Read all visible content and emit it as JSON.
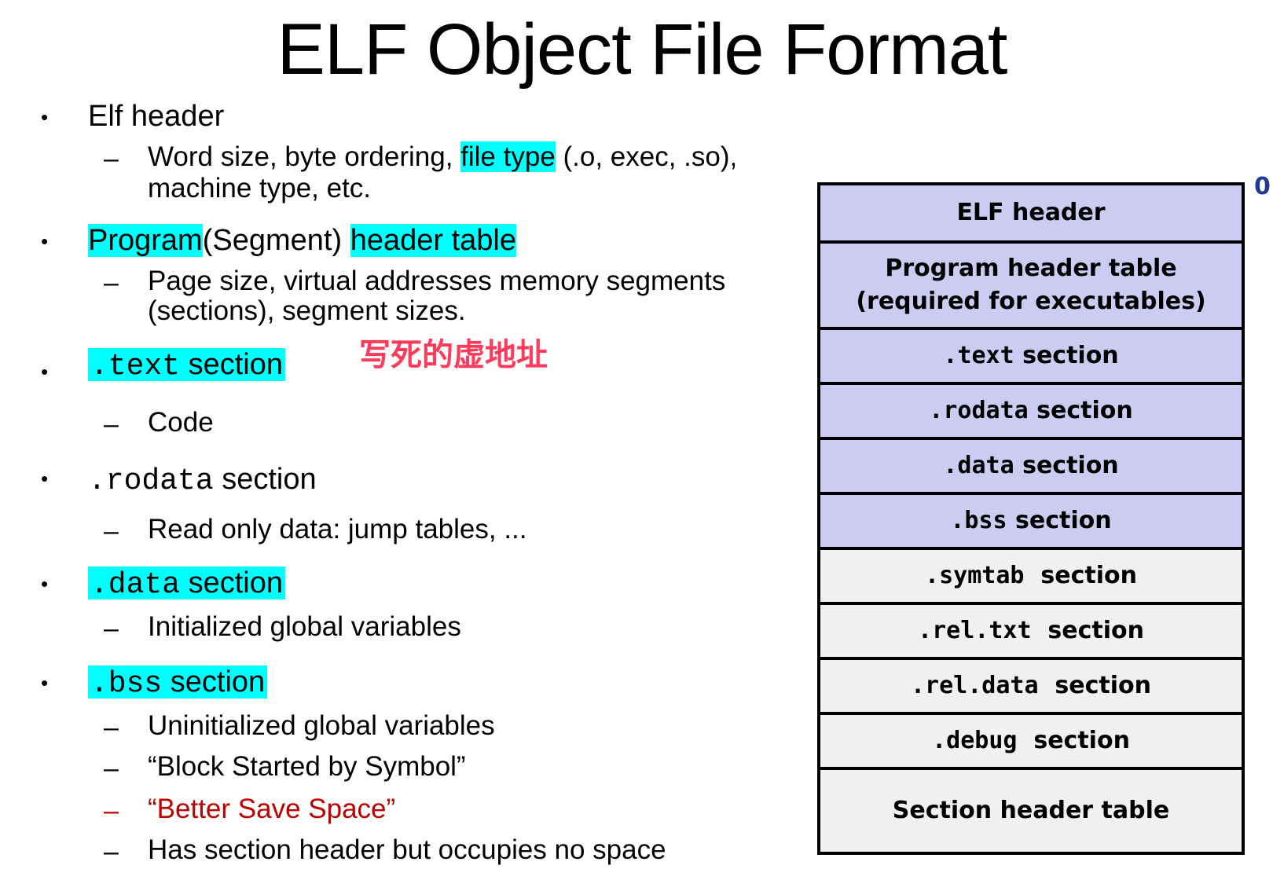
{
  "title": "ELF Object File Format",
  "colors": {
    "highlight": "#00ffff",
    "box_blue": "#ccccf3",
    "box_gray": "#f0f0f0",
    "red_text": "#c00000",
    "note_red": "#ff3b5c",
    "offset_blue": "#1f3a93"
  },
  "bullet_glyph": "•",
  "dash_glyph": "–",
  "left": {
    "elf": {
      "label": "Elf header",
      "sub1_a": "Word size, byte ordering, ",
      "sub1_hl": "file type",
      "sub1_b": " (.o, exec, .so),",
      "sub1_line2": "machine type, etc."
    },
    "program": {
      "hl1": "Program",
      "mid": "(Segment) ",
      "hl2": "header table",
      "sub1": "Page size, virtual addresses memory segments",
      "sub2": "(sections), segment sizes."
    },
    "note": "写死的虚地址",
    "text": {
      "mono": ".text",
      "word": " section",
      "sub": "Code"
    },
    "rodata": {
      "mono": ".rodata",
      "word": " section",
      "sub": "Read only data: jump tables, ..."
    },
    "data": {
      "mono": ".data",
      "word": " section",
      "sub": "Initialized global variables"
    },
    "bss": {
      "mono": ".bss",
      "word": " section",
      "sub1": "Uninitialized global variables",
      "sub2": "“Block Started by Symbol”",
      "sub3": "“Better Save Space”",
      "sub4": "Has section header but occupies no space"
    }
  },
  "diagram": {
    "offset_label": "0",
    "cells": {
      "elf_header": "ELF header",
      "pht_line1": "Program header table",
      "pht_line2": "(required for executables)",
      "text_mono": ".text",
      "text_word": " section",
      "rodata_mono": ".rodata",
      "rodata_word": " section",
      "data_mono": ".data",
      "data_word": " section",
      "bss_mono": ".bss",
      "bss_word": " section",
      "symtab_mono": ".symtab",
      "symtab_word": "  section",
      "reltxt_mono": ".rel.txt",
      "reltxt_word": "  section",
      "reldata_mono": ".rel.data",
      "reldata_word": "  section",
      "debug_mono": ".debug",
      "debug_word": "  section",
      "sht": "Section header table"
    }
  }
}
